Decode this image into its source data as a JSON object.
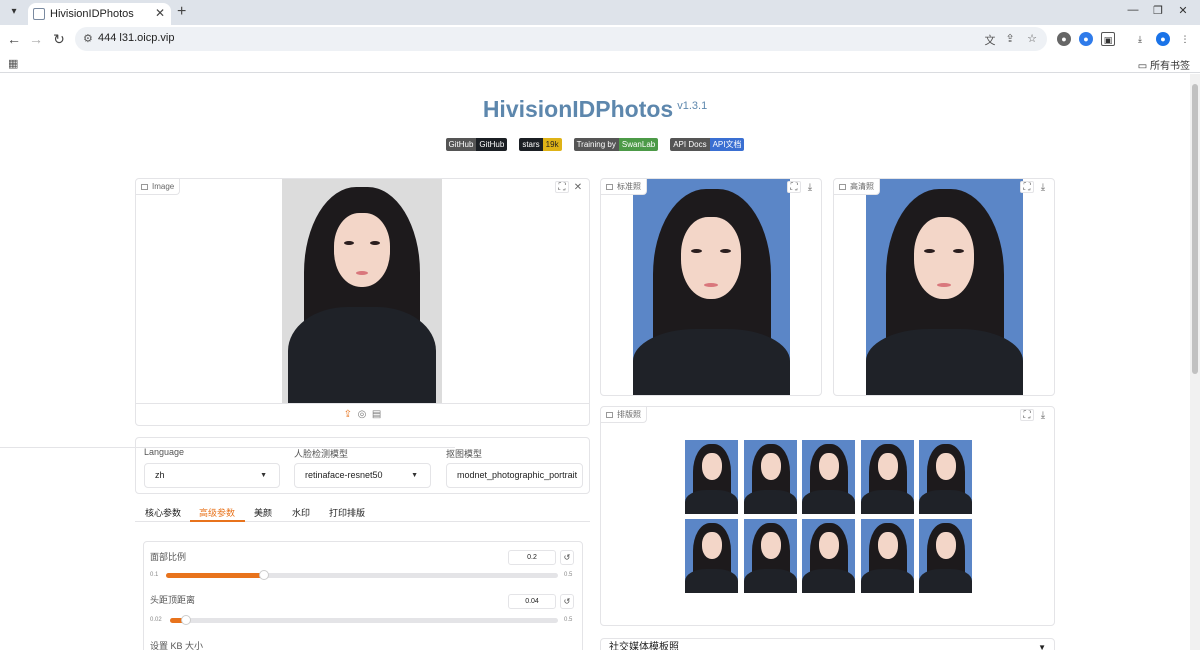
{
  "browser": {
    "tab_title": "HivisionIDPhotos",
    "url": "444      l31.oicp.vip",
    "bookmark_folder": "所有书签"
  },
  "app": {
    "title": "HivisionIDPhotos",
    "version": "v1.3.1",
    "badges": [
      {
        "left": "GitHub",
        "right": "GitHub"
      },
      {
        "left": "stars",
        "right": "19k"
      },
      {
        "left": "Training by",
        "right": "SwanLab"
      },
      {
        "left": "API Docs",
        "right": "API文档"
      }
    ]
  },
  "input_panel": {
    "label": "Image"
  },
  "output_panels": {
    "standard": {
      "label": "标准照"
    },
    "hd": {
      "label": "高清照"
    },
    "layout": {
      "label": "排版照"
    }
  },
  "settings": {
    "language_label": "Language",
    "language_value": "zh",
    "face_model_label": "人脸检测模型",
    "face_model_value": "retinaface-resnet50",
    "matting_model_label": "抠图模型",
    "matting_model_value": "modnet_photographic_portrait"
  },
  "tabs": [
    "核心参数",
    "高级参数",
    "美颜",
    "水印",
    "打印排版"
  ],
  "sliders": {
    "face_ratio": {
      "label": "面部比例",
      "value": "0.2",
      "min": "0.1",
      "max": "0.5",
      "fraction": 0.25
    },
    "head_top": {
      "label": "头距顶距离",
      "value": "0.04",
      "min": "0.02",
      "max": "0.5",
      "fraction": 0.04
    },
    "kb_size": {
      "label": "设置 KB 大小"
    }
  },
  "accordion": {
    "label": "社交媒体模板照"
  },
  "colors": {
    "accent": "#e8731c",
    "photo_bg": "#5b86c7",
    "title": "#5d87ad"
  }
}
